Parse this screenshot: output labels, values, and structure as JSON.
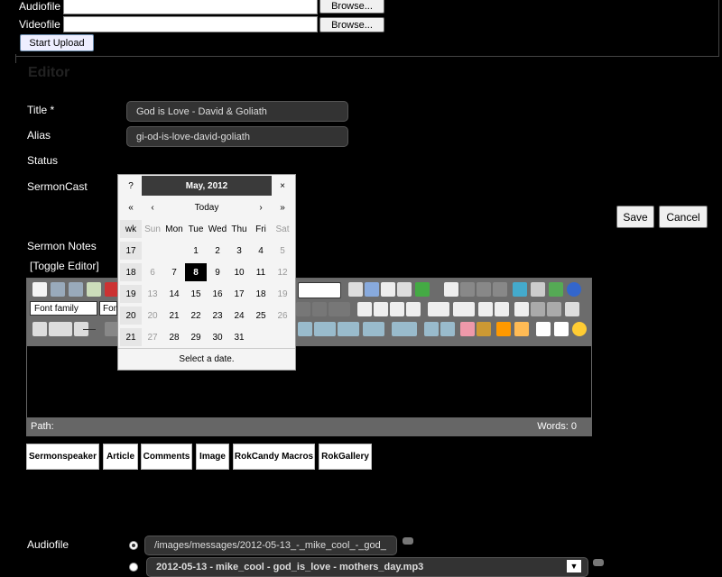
{
  "upload": {
    "audio_label": "Audiofile",
    "video_label": "Videofile",
    "browse_label": "Browse...",
    "start_upload_label": "Start Upload"
  },
  "editor_section": {
    "heading": "Editor",
    "title_label": "Title *",
    "title_value": "God is Love - David & Goliath",
    "alias_label": "Alias",
    "alias_value": "gi-od-is-love-david-goliath",
    "status_label": "Status",
    "sermoncast_label": "SermonCast",
    "sermon_notes_label": "Sermon Notes",
    "toggle_editor_label": "[Toggle Editor]"
  },
  "actions": {
    "save_label": "Save",
    "cancel_label": "Cancel"
  },
  "editor": {
    "font_family_label": "Font family",
    "font_size_label": "Font",
    "path_label": "Path:",
    "words_label": "Words: 0"
  },
  "calendar": {
    "help": "?",
    "title": "May, 2012",
    "close": "×",
    "prev_year": "«",
    "prev_month": "‹",
    "today": "Today",
    "next_month": "›",
    "next_year": "»",
    "weekday_headers": [
      "wk",
      "Sun",
      "Mon",
      "Tue",
      "Wed",
      "Thu",
      "Fri",
      "Sat"
    ],
    "weeks": [
      {
        "wk": "17",
        "days": [
          "",
          "",
          "1",
          "2",
          "3",
          "4",
          "5"
        ]
      },
      {
        "wk": "18",
        "days": [
          "6",
          "7",
          "8",
          "9",
          "10",
          "11",
          "12"
        ]
      },
      {
        "wk": "19",
        "days": [
          "13",
          "14",
          "15",
          "16",
          "17",
          "18",
          "19"
        ]
      },
      {
        "wk": "20",
        "days": [
          "20",
          "21",
          "22",
          "23",
          "24",
          "25",
          "26"
        ]
      },
      {
        "wk": "21",
        "days": [
          "27",
          "28",
          "29",
          "30",
          "31",
          "",
          ""
        ]
      }
    ],
    "selected_day": "8",
    "footer": "Select a date."
  },
  "editor_buttons": [
    "Sermonspeaker",
    "Article",
    "Comments",
    "Image",
    "RokCandy Macros",
    "RokGallery"
  ],
  "files": {
    "audio_label": "Audiofile",
    "audio_path": "/images/messages/2012-05-13_-_mike_cool_-_god_",
    "audio_select": "2012-05-13 - mike_cool - god_is_love - mothers_day.mp3"
  },
  "colors": {
    "background": "#000000",
    "field_bg": "#333333",
    "toolbar_bg": "#6c6c6c"
  }
}
